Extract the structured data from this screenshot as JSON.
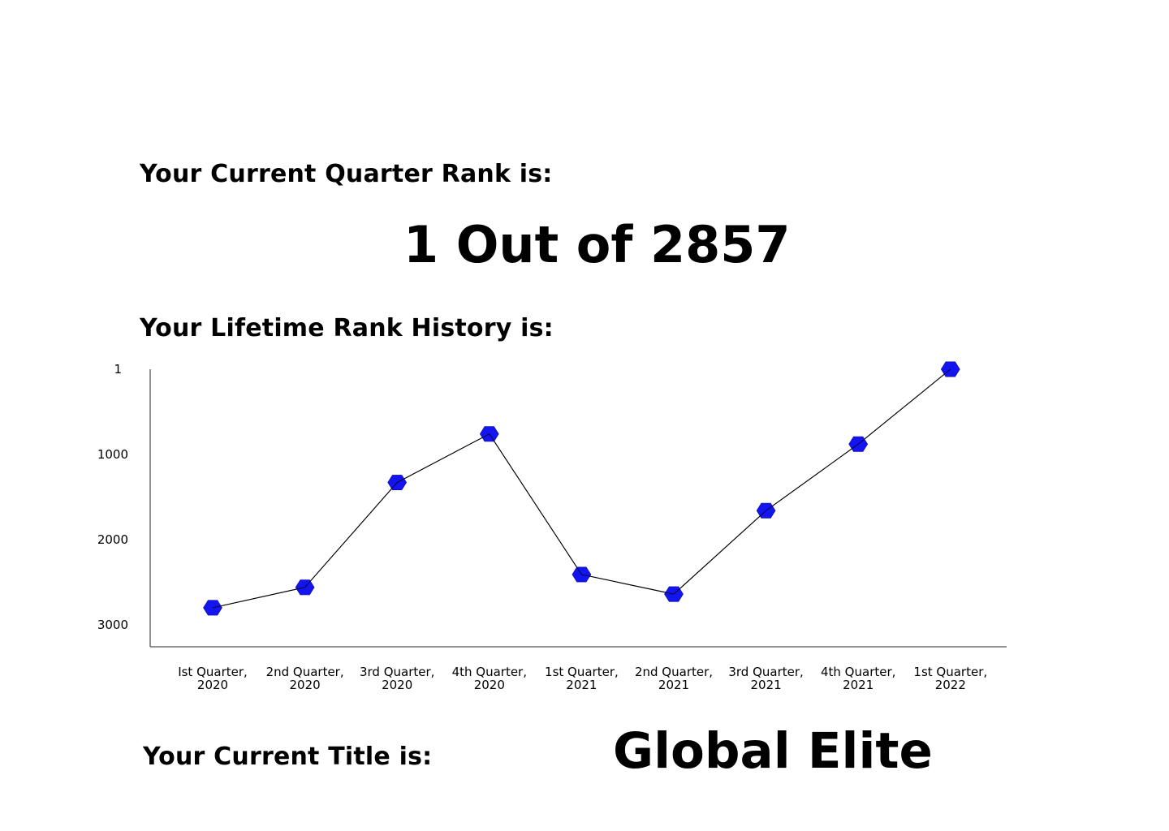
{
  "headings": {
    "current_rank": "Your Current Quarter Rank is:",
    "history": "Your Lifetime Rank History is:",
    "title": "Your Current Title is:"
  },
  "rank": {
    "value": "1 Out of 2857"
  },
  "title": {
    "value": "Global Elite"
  },
  "colors": {
    "marker": "#1414f0",
    "line": "#000000",
    "axis": "#555555"
  },
  "chart_data": {
    "type": "line",
    "title": "",
    "xlabel": "",
    "ylabel": "",
    "y_inverted": true,
    "ylim": [
      1,
      3400
    ],
    "yticks": [
      1,
      1000,
      2000,
      3000
    ],
    "ytick_labels": [
      "1",
      "1000",
      "2000",
      "3000"
    ],
    "categories": [
      [
        "Ist Quarter,",
        "2020"
      ],
      [
        "2nd Quarter,",
        "2020"
      ],
      [
        "3rd Quarter,",
        "2020"
      ],
      [
        "4th Quarter,",
        "2020"
      ],
      [
        "1st Quarter,",
        "2021"
      ],
      [
        "2nd Quarter,",
        "2021"
      ],
      [
        "3rd Quarter,",
        "2021"
      ],
      [
        "4th Quarter,",
        "2021"
      ],
      [
        "1st Quarter,",
        "2022"
      ]
    ],
    "series": [
      {
        "values": [
          2800,
          2560,
          1330,
          760,
          2410,
          2640,
          1660,
          880,
          1
        ]
      }
    ],
    "marker": "hexagon"
  }
}
